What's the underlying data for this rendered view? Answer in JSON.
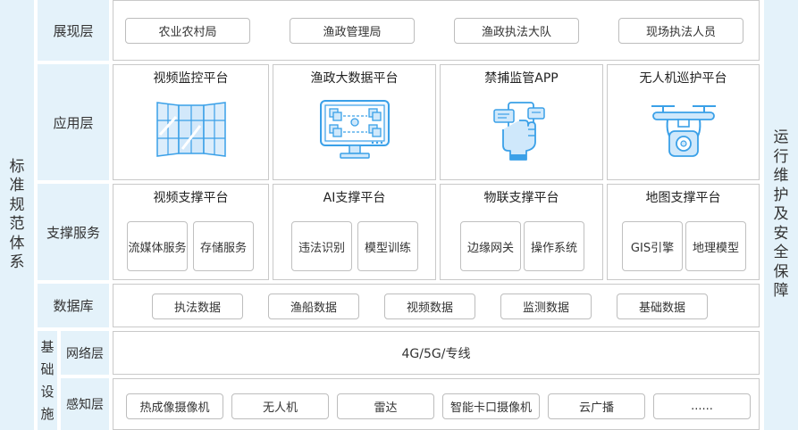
{
  "left_side": [
    "标",
    "准",
    "规",
    "范",
    "体",
    "系"
  ],
  "right_side": [
    "运",
    "行",
    "维",
    "护",
    "及",
    "安",
    "全",
    "保",
    "障"
  ],
  "presentation": {
    "label": "展现层",
    "items": [
      "农业农村局",
      "渔政管理局",
      "渔政执法大队",
      "现场执法人员"
    ]
  },
  "application": {
    "label": "应用层",
    "platforms": [
      {
        "title": "视频监控平台",
        "icon": "video-wall-icon"
      },
      {
        "title": "渔政大数据平台",
        "icon": "big-data-monitor-icon"
      },
      {
        "title": "禁捕监管APP",
        "icon": "mobile-app-hand-icon"
      },
      {
        "title": "无人机巡护平台",
        "icon": "drone-icon"
      }
    ]
  },
  "support": {
    "label": "支撑服务",
    "platforms": [
      {
        "title": "视频支撑平台",
        "services": [
          "流媒体服务",
          "存储服务"
        ]
      },
      {
        "title": "AI支撑平台",
        "services": [
          "违法识别",
          "模型训练"
        ]
      },
      {
        "title": "物联支撑平台",
        "services": [
          "边缘网关",
          "操作系统"
        ]
      },
      {
        "title": "地图支撑平台",
        "services": [
          "GIS引擎",
          "地理模型"
        ]
      }
    ]
  },
  "database": {
    "label": "数据库",
    "items": [
      "执法数据",
      "渔船数据",
      "视频数据",
      "监测数据",
      "基础数据"
    ]
  },
  "infrastructure": {
    "label": [
      "基",
      "础",
      "设",
      "施"
    ],
    "network": {
      "label": "网络层",
      "content": "4G/5G/专线"
    },
    "perception": {
      "label": "感知层",
      "items": [
        "热成像摄像机",
        "无人机",
        "雷达",
        "智能卡口摄像机",
        "云广播",
        "......"
      ]
    }
  },
  "colors": {
    "side_bg": "#e4f2fa",
    "icon_blue": "#3aa0e8",
    "icon_light": "#cfe8fb",
    "border": "#c9c9c9"
  }
}
